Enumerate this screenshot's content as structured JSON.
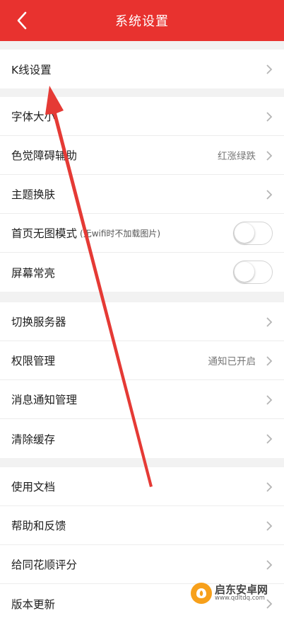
{
  "header": {
    "title": "系统设置",
    "back_icon": "chevron-left-icon"
  },
  "colors": {
    "accent": "#e8322f",
    "background": "#f2f2f2",
    "annotation_arrow": "#e53a35"
  },
  "groups": [
    {
      "rows": [
        {
          "label": "K线设置",
          "type": "link"
        }
      ]
    },
    {
      "rows": [
        {
          "label": "字体大小",
          "type": "link"
        },
        {
          "label": "色觉障碍辅助",
          "type": "link",
          "value": "红涨绿跌"
        },
        {
          "label": "主题换肤",
          "type": "link"
        },
        {
          "label": "首页无图模式",
          "hint": "(无wifi时不加载图片)",
          "type": "toggle",
          "on": false
        },
        {
          "label": "屏幕常亮",
          "type": "toggle",
          "on": false
        }
      ]
    },
    {
      "rows": [
        {
          "label": "切换服务器",
          "type": "link"
        },
        {
          "label": "权限管理",
          "type": "link",
          "value": "通知已开启"
        },
        {
          "label": "消息通知管理",
          "type": "link"
        },
        {
          "label": "清除缓存",
          "type": "link"
        }
      ]
    },
    {
      "rows": [
        {
          "label": "使用文档",
          "type": "link"
        },
        {
          "label": "帮助和反馈",
          "type": "link"
        },
        {
          "label": "给同花顺评分",
          "type": "link"
        },
        {
          "label": "版本更新",
          "type": "link"
        }
      ]
    }
  ],
  "watermark": {
    "name": "启东安卓网",
    "url": "www.qdltdq.com"
  }
}
